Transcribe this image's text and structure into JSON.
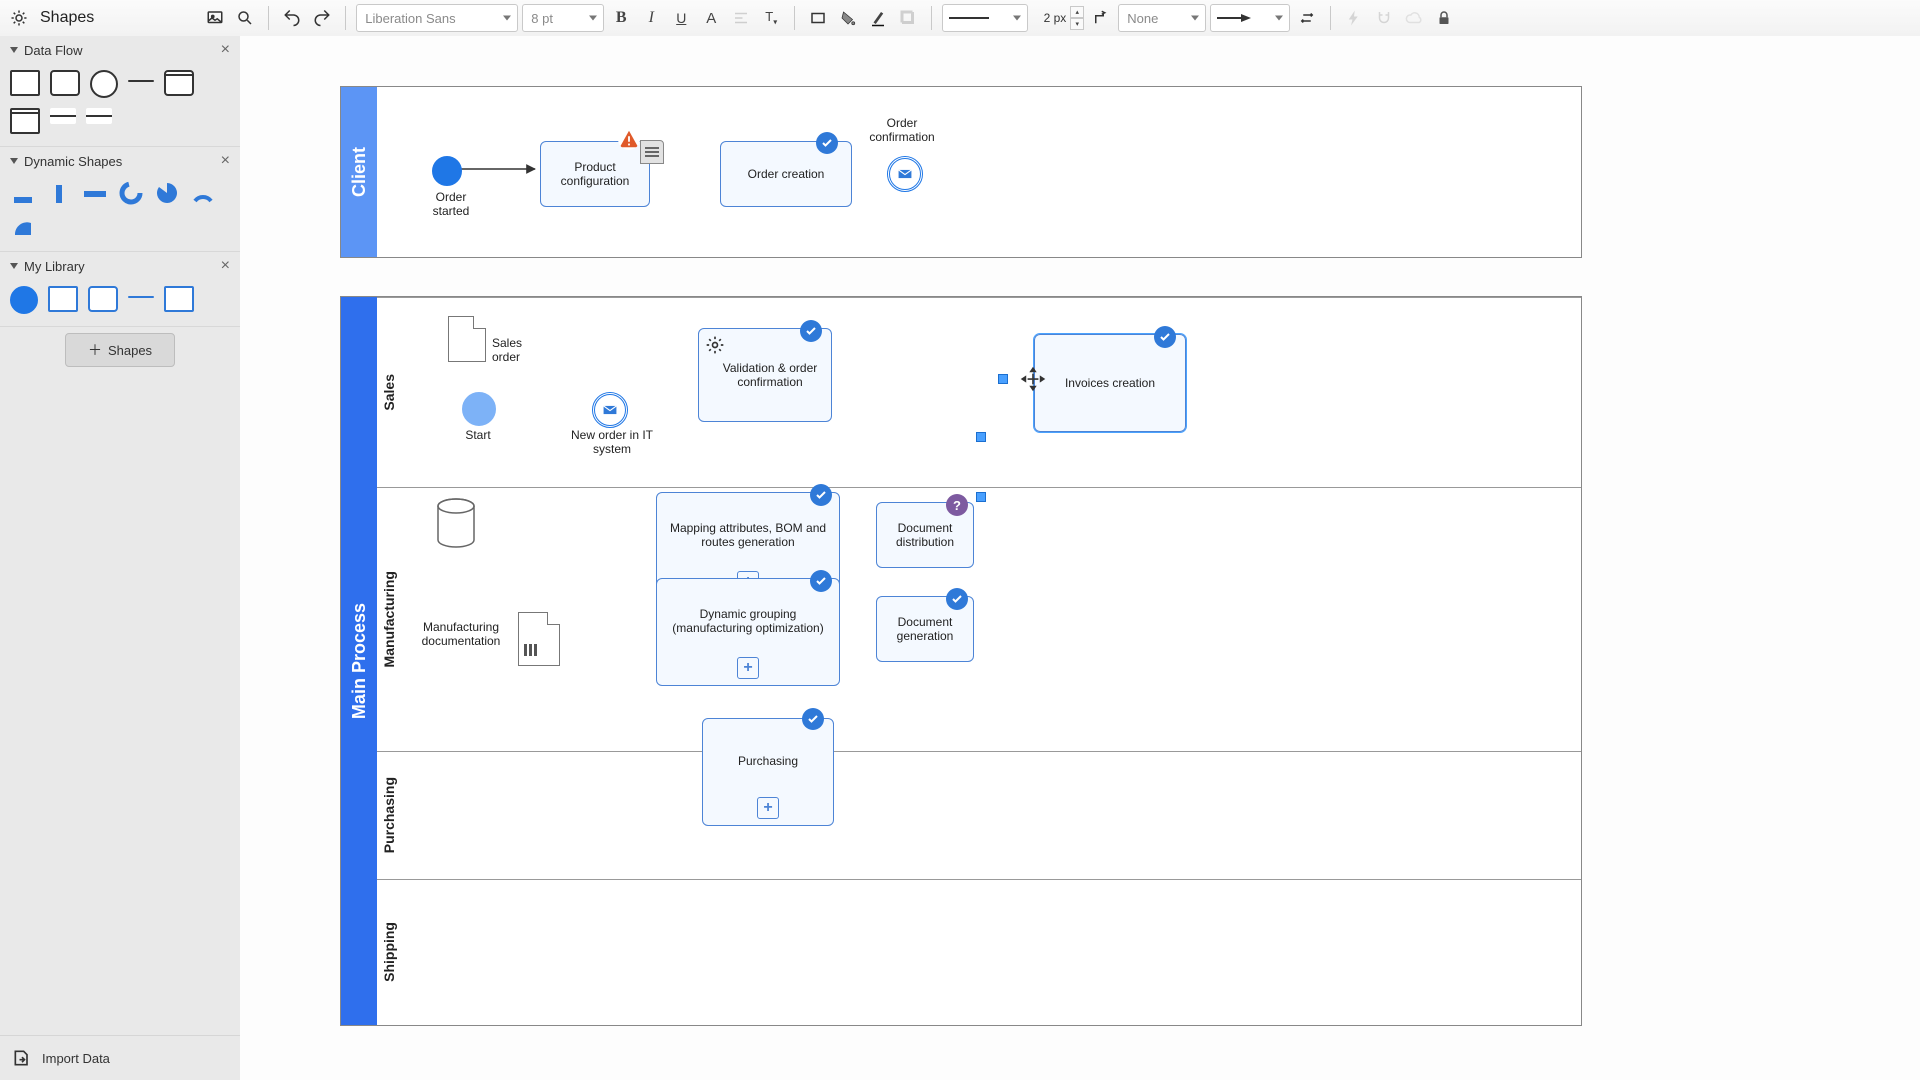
{
  "toolbar": {
    "app_label": "Shapes",
    "font": "Liberation Sans",
    "font_size": "8 pt",
    "stroke_width": "2 px",
    "line_cap": "None"
  },
  "sidebar": {
    "sections": {
      "data_flow": {
        "title": "Data Flow"
      },
      "dynamic": {
        "title": "Dynamic Shapes"
      },
      "library": {
        "title": "My Library"
      }
    },
    "shapes_btn": "Shapes",
    "import": "Import Data"
  },
  "pools": {
    "client": "Client",
    "main": "Main Process"
  },
  "lanes": {
    "sales": "Sales",
    "manufacturing": "Manufacturing",
    "purchasing": "Purchasing",
    "shipping": "Shipping"
  },
  "nodes": {
    "order_started": "Order\nstarted",
    "product_config": "Product configuration",
    "order_creation": "Order creation",
    "order_confirm_lbl": "Order\nconfirmation",
    "sales_order": "Sales\norder",
    "start": "Start",
    "new_order_it": "New order in IT\nsystem",
    "validation": "Validation & order confirmation",
    "invoices": "Invoices creation",
    "mapping": "Mapping attributes, BOM and routes generation",
    "dyn_group": "Dynamic grouping (manufacturing optimization)",
    "doc_gen": "Document generation",
    "doc_dist": "Document distribution",
    "manu_doc": "Manufacturing\ndocumentation",
    "purchasing": "Purchasing"
  },
  "colors": {
    "lane_blue": "#2f6fed",
    "node_border": "#4d84d6",
    "check": "#2f79d8",
    "warn": "#e05a2a",
    "help": "#7d5aa0"
  }
}
